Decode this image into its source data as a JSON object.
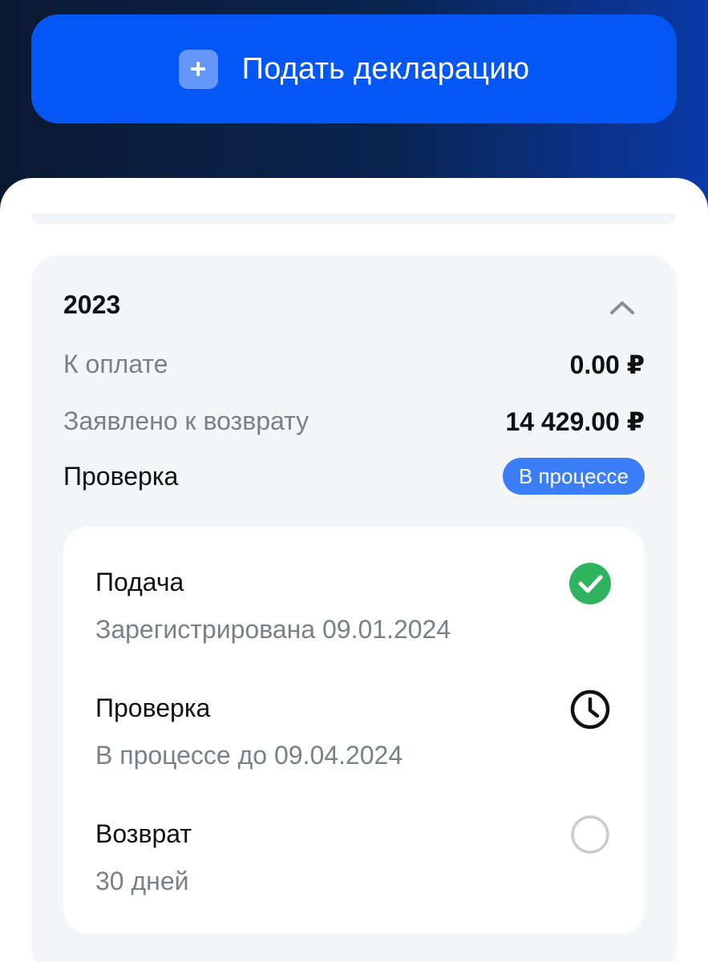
{
  "header": {
    "submit_button_label": "Подать декларацию",
    "plus_icon": "plus-icon"
  },
  "declaration": {
    "year": "2023",
    "rows": [
      {
        "label": "К оплате",
        "value": "0.00 ₽"
      },
      {
        "label": "Заявлено к возврату",
        "value": "14 429.00 ₽"
      }
    ],
    "check": {
      "label": "Проверка",
      "status": "В процессе"
    },
    "steps": [
      {
        "title": "Подача",
        "subtitle": "Зарегистрирована 09.01.2024",
        "icon": "check-circle-icon"
      },
      {
        "title": "Проверка",
        "subtitle": "В процессе до 09.04.2024",
        "icon": "clock-icon"
      },
      {
        "title": "Возврат",
        "subtitle": "30 дней",
        "icon": "empty-circle-icon"
      }
    ]
  },
  "colors": {
    "accent": "#0557f5",
    "badge": "#3b7ef7",
    "success": "#2fb35e",
    "muted_text": "#7b7f86"
  }
}
